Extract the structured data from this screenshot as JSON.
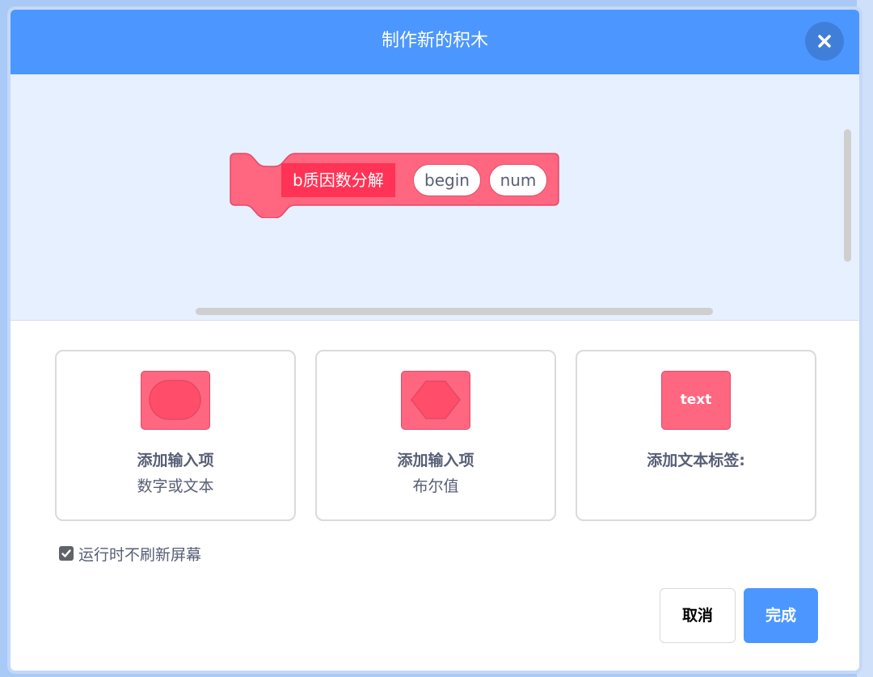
{
  "dialog": {
    "title": "制作新的积木",
    "close_icon": "close-icon"
  },
  "block": {
    "name": "b质因数分解",
    "args": [
      "begin",
      "num"
    ]
  },
  "options": [
    {
      "title": "添加输入项",
      "subtitle": "数字或文本",
      "icon": "number-text-input-icon"
    },
    {
      "title": "添加输入项",
      "subtitle": "布尔值",
      "icon": "boolean-input-icon"
    },
    {
      "title": "添加文本标签:",
      "icon_text": "text",
      "icon": "text-label-icon"
    }
  ],
  "run_without_refresh": {
    "label": "运行时不刷新屏幕",
    "checked": true
  },
  "buttons": {
    "cancel": "取消",
    "done": "完成"
  },
  "colors": {
    "header": "#4c97ff",
    "block": "#ff6680",
    "block_name_bg": "#ff3355",
    "workspace": "#e6f0ff"
  }
}
